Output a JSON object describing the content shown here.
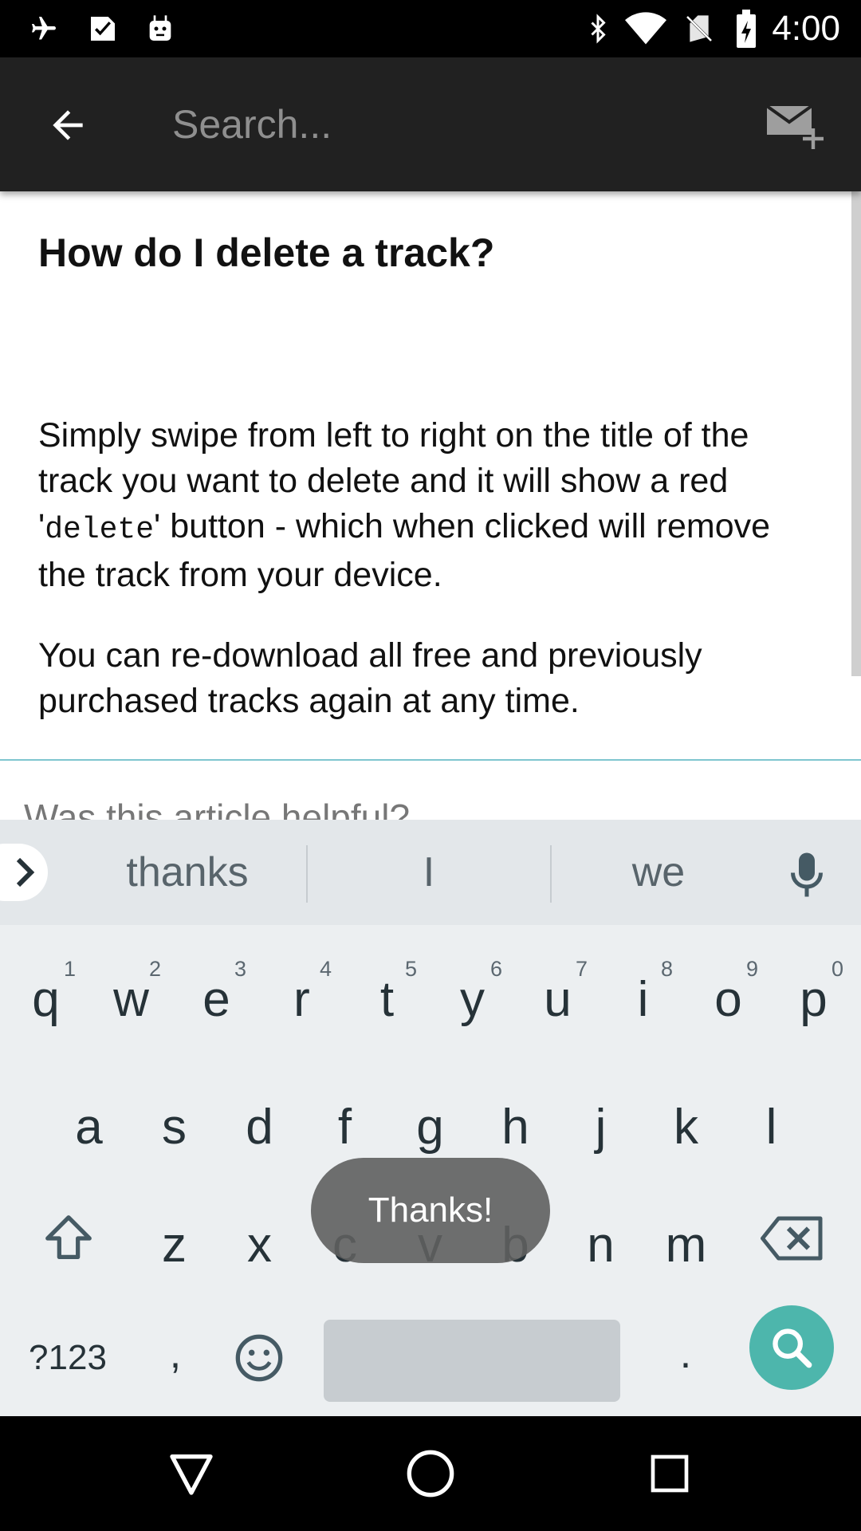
{
  "status_bar": {
    "time": "4:00",
    "icons": [
      "airplane-mode-icon",
      "play-store-download-icon",
      "android-debug-icon",
      "bluetooth-icon",
      "wifi-icon",
      "no-sim-icon",
      "battery-charging-icon"
    ]
  },
  "app_bar": {
    "search_placeholder": "Search...",
    "back_icon": "arrow-back-icon",
    "contact_icon": "mail-add-icon",
    "background": "#212121"
  },
  "article": {
    "title": "How do I delete a track?",
    "para1_before": "Simply swipe from left to right on the title of the track you want to delete and it will show a red '",
    "para1_code": "delete",
    "para1_after": "' button - which when clicked will remove the track from your device.",
    "para2": "You can re-download all free and previously purchased tracks again at any time.",
    "helpful_prompt": "Was this article helpful?"
  },
  "keyboard": {
    "suggestions": [
      "thanks",
      "I",
      "we"
    ],
    "row1": [
      {
        "label": "q",
        "hint": "1"
      },
      {
        "label": "w",
        "hint": "2"
      },
      {
        "label": "e",
        "hint": "3"
      },
      {
        "label": "r",
        "hint": "4"
      },
      {
        "label": "t",
        "hint": "5"
      },
      {
        "label": "y",
        "hint": "6"
      },
      {
        "label": "u",
        "hint": "7"
      },
      {
        "label": "i",
        "hint": "8"
      },
      {
        "label": "o",
        "hint": "9"
      },
      {
        "label": "p",
        "hint": "0"
      }
    ],
    "row2": [
      "a",
      "s",
      "d",
      "f",
      "g",
      "h",
      "j",
      "k",
      "l"
    ],
    "row3": [
      "z",
      "x",
      "c",
      "v",
      "b",
      "n",
      "m"
    ],
    "symbols_label": "?123",
    "comma_label": ",",
    "period_label": ".",
    "action_color": "#4db6ac"
  },
  "toast": {
    "text": "Thanks!"
  },
  "nav_bar": {
    "icons": [
      "back-triangle-icon",
      "home-circle-icon",
      "recents-square-icon"
    ]
  }
}
